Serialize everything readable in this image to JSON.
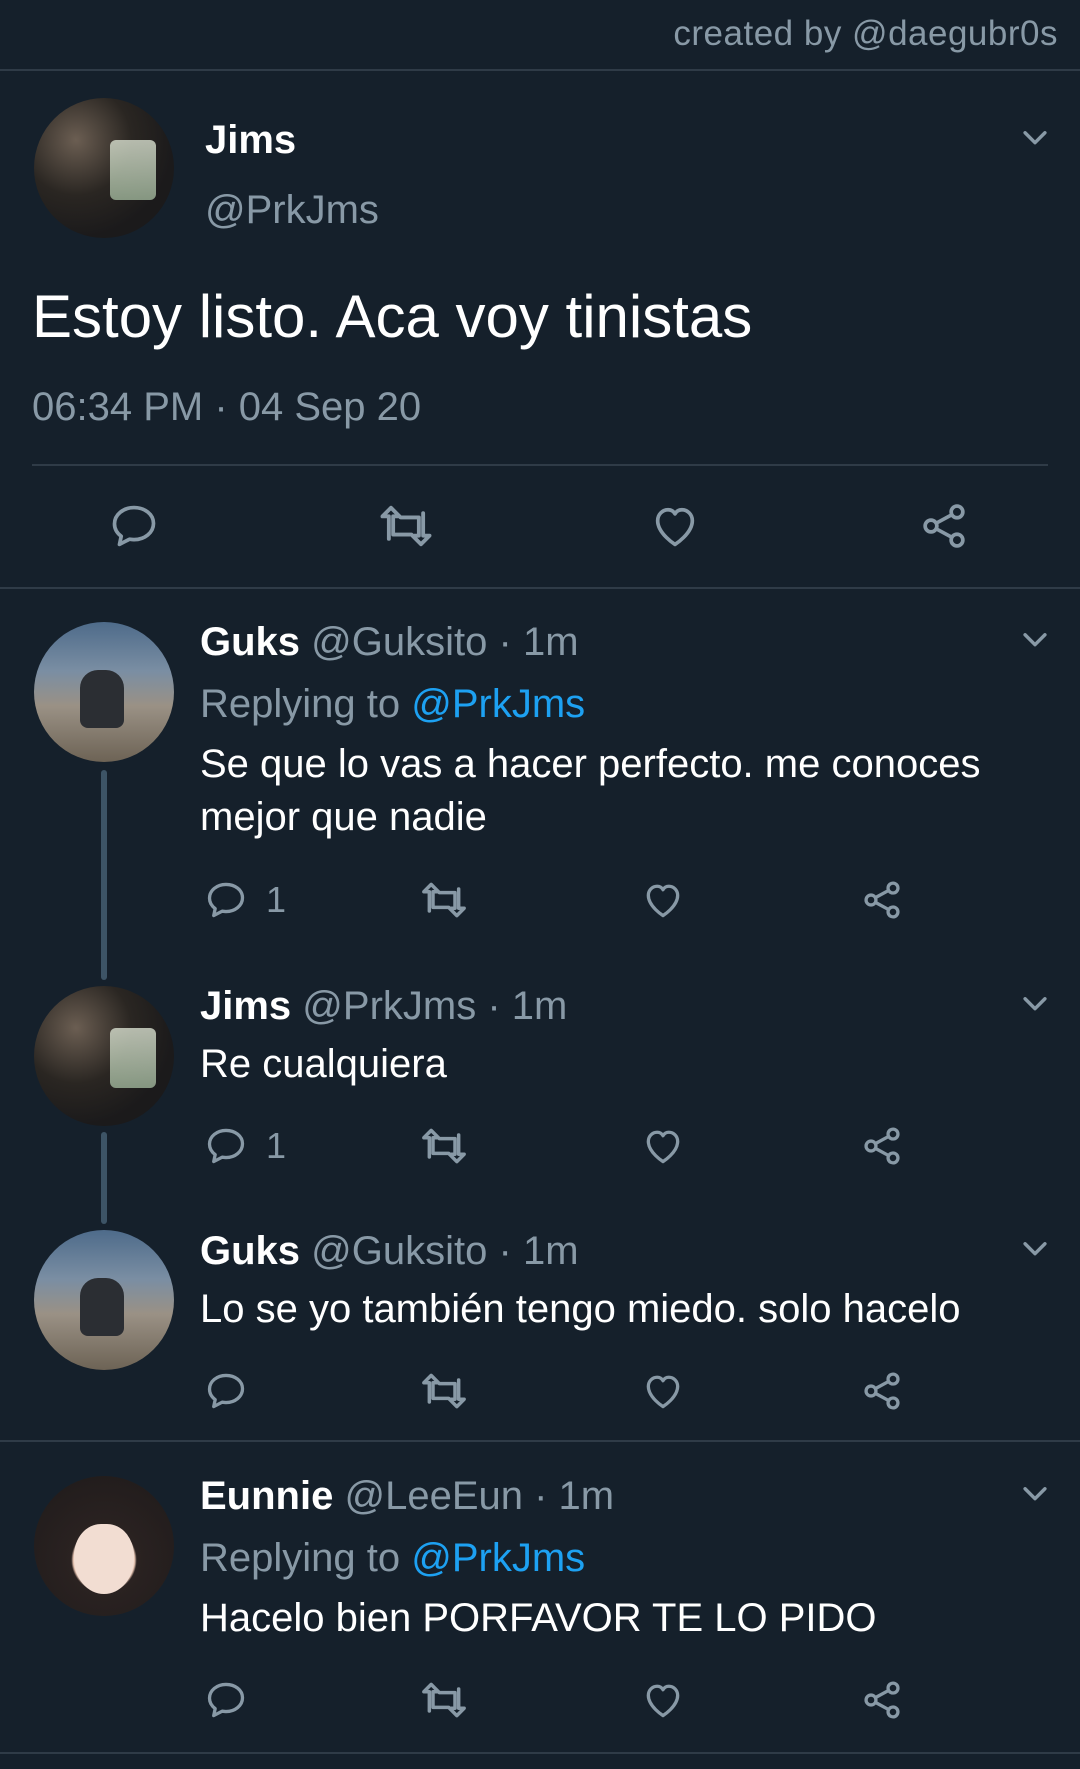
{
  "credit": "created by @daegubr0s",
  "main_tweet": {
    "name": "Jims",
    "handle": "@PrkJms",
    "text": "Estoy listo. Aca voy tinistas",
    "timestamp": "06:34 PM · 04 Sep 20"
  },
  "replies": [
    {
      "name": "Guks",
      "handle": "@Guksito",
      "time": "· 1m",
      "replying_label": "Replying to",
      "replying_to": "@PrkJms",
      "text_line1": "Se que lo vas a hacer perfecto. me conoces",
      "text_line2": "mejor que nadie",
      "reply_count": "1"
    },
    {
      "name": "Jims",
      "handle": "@PrkJms",
      "time": "· 1m",
      "text_line1": "Re cualquiera",
      "reply_count": "1"
    },
    {
      "name": "Guks",
      "handle": "@Guksito",
      "time": "· 1m",
      "text_line1": "Lo se yo también tengo miedo. solo hacelo"
    },
    {
      "name": "Eunnie",
      "handle": "@LeeEun",
      "time": "· 1m",
      "replying_label": "Replying to",
      "replying_to": "@PrkJms",
      "text_line1": "Hacelo bien PORFAVOR TE LO PIDO"
    }
  ],
  "icons": {
    "reply": "reply-icon",
    "retweet": "retweet-icon",
    "like": "heart-icon",
    "share": "share-icon",
    "menu": "chevron-down-icon"
  },
  "colors": {
    "background": "#15202b",
    "muted": "#8899a6",
    "link": "#1da1f2",
    "divider": "#2f3b47"
  }
}
